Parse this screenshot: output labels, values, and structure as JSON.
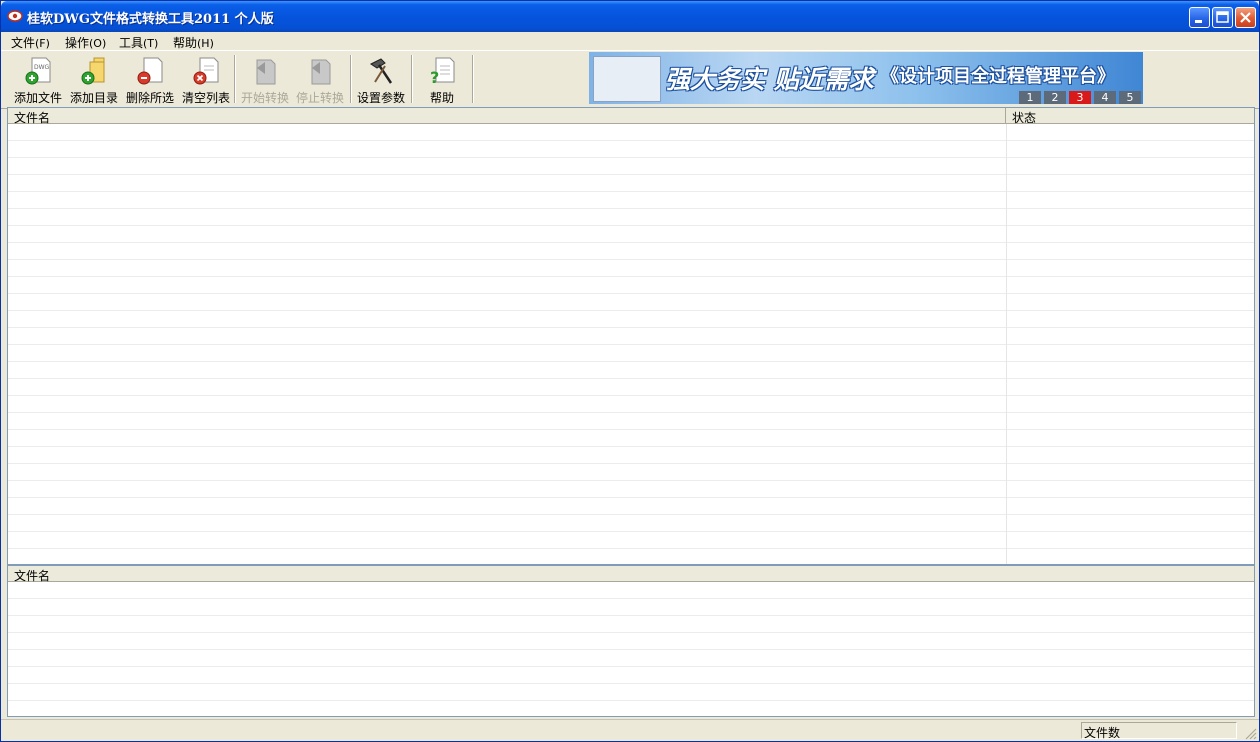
{
  "window": {
    "title": "桂软DWG文件格式转换工具2011 个人版"
  },
  "menu": [
    {
      "label": "文件",
      "key": "(F)"
    },
    {
      "label": "操作",
      "key": "(O)"
    },
    {
      "label": "工具",
      "key": "(T)"
    },
    {
      "label": "帮助",
      "key": "(H)"
    }
  ],
  "toolbar": {
    "add_file": "添加文件",
    "add_dir": "添加目录",
    "delete_selected": "删除所选",
    "clear_list": "清空列表",
    "start_convert": "开始转换",
    "stop_convert": "停止转换",
    "settings": "设置参数",
    "help": "帮助",
    "dwg_tag": "DWG"
  },
  "banner": {
    "slogan": "强大务实 贴近需求",
    "product": "《设计项目全过程管理平台》",
    "pages": [
      "1",
      "2",
      "3",
      "4",
      "5"
    ],
    "active_page": "3"
  },
  "file_list": {
    "col_name": "文件名",
    "col_status": "状态"
  },
  "result_list": {
    "col_name": "文件名"
  },
  "statusbar": {
    "file_count_label": "文件数"
  },
  "colors": {
    "title_bar": "#0654dd",
    "banner_active_page": "#d81a1a",
    "window_bg": "#ece9d8"
  }
}
